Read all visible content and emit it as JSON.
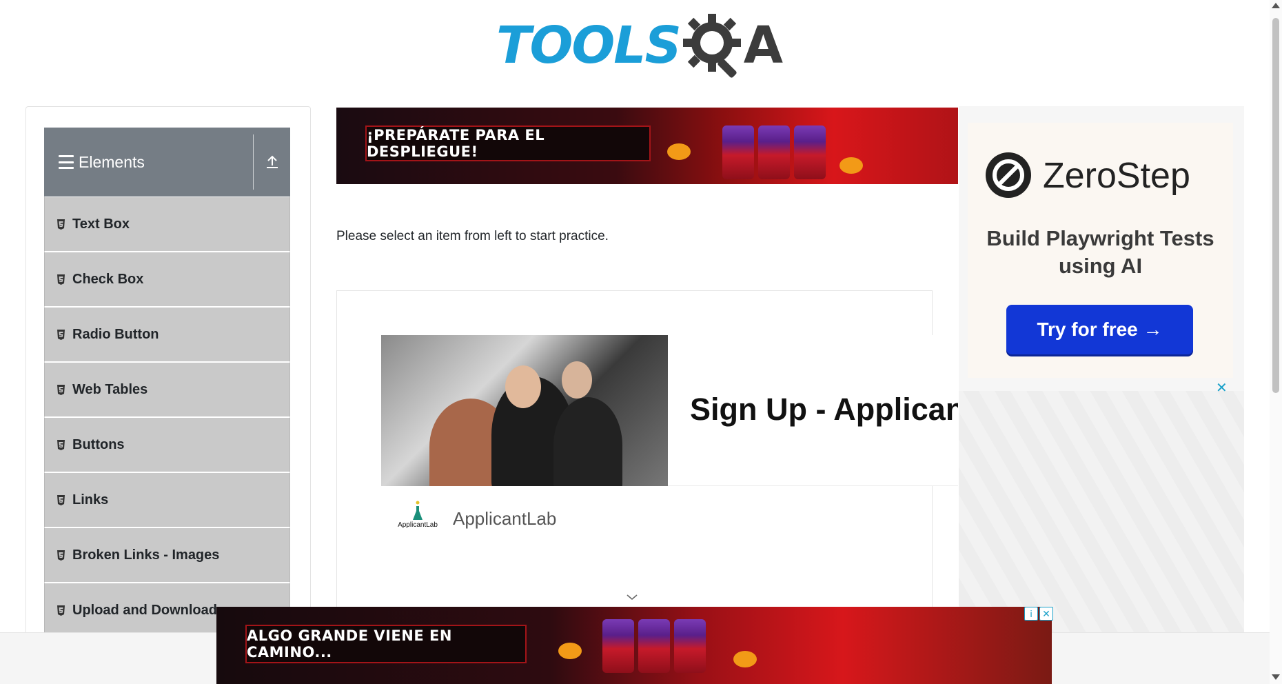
{
  "header": {
    "logo_text": "TOOLS",
    "logo_suffix": "A"
  },
  "sidebar": {
    "group_title": "Elements",
    "items": [
      {
        "label": "Text Box"
      },
      {
        "label": "Check Box"
      },
      {
        "label": "Radio Button"
      },
      {
        "label": "Web Tables"
      },
      {
        "label": "Buttons"
      },
      {
        "label": "Links"
      },
      {
        "label": "Broken Links - Images"
      },
      {
        "label": "Upload and Download"
      }
    ]
  },
  "main": {
    "intro": "Please select an item from left to start practice.",
    "top_banner_text": "¡PREPÁRATE PARA EL DESPLIEGUE!",
    "ad": {
      "headline": "Sign Up - Applicantl",
      "advertiser_logo_text": "ApplicantLab",
      "advertiser_name": "ApplicantLab"
    }
  },
  "right_ad": {
    "brand": "ZeroStep",
    "tagline": "Build Playwright Tests using AI",
    "cta": "Try for free →",
    "close": "✕"
  },
  "bottom_banner": {
    "text": "ALGO GRANDE VIENE EN CAMINO..."
  },
  "colors": {
    "logo_blue": "#1b9ed8",
    "group_header": "#757d85",
    "menu_item_bg": "#c9c9c9",
    "cta_blue": "#1237d6"
  }
}
